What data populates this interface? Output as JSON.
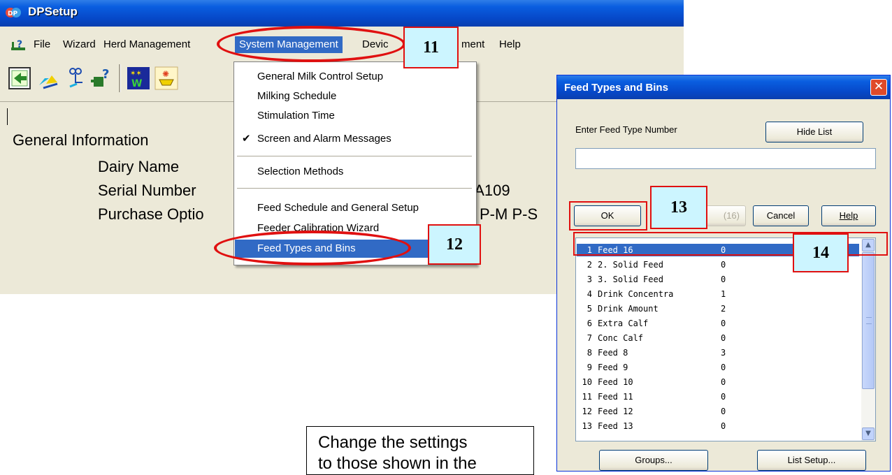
{
  "window": {
    "title": "DPSetup"
  },
  "menubar": {
    "items": [
      "File",
      "Wizard",
      "Herd Management",
      "System Management",
      "Device Management",
      "Help"
    ],
    "device_partial_left": "Devic",
    "device_partial_right": "ment"
  },
  "toolbar": {
    "icons": [
      "import-icon",
      "cursor-arrow-icon",
      "milk-network-icon",
      "plug-help-icon",
      "wizard-icon",
      "alarm-icon"
    ]
  },
  "content": {
    "section_heading": "General Information",
    "dairy_name_label": "Dairy Name",
    "serial_number_label": "Serial Number",
    "serial_number_value_partial": "7A109",
    "purchase_options_label": "Purchase Optio",
    "purchase_options_value_partial": "P-M  P-S"
  },
  "dropdown": {
    "items": [
      {
        "label": "General Milk Control Setup"
      },
      {
        "label": "Milking Schedule"
      },
      {
        "label": "Stimulation Time"
      },
      {
        "label": "Screen and Alarm Messages",
        "checked": true
      },
      {
        "label": "Selection Methods"
      },
      {
        "label": "Feed Schedule and General Setup"
      },
      {
        "label": "Feeder Calibration Wizard"
      },
      {
        "label": "Feed Types and Bins",
        "highlighted": true
      }
    ],
    "check_mark": "✔"
  },
  "callouts": {
    "c11": "11",
    "c12": "12",
    "c13": "13",
    "c14": "14"
  },
  "dialog": {
    "title": "Feed Types and Bins",
    "label": "Enter Feed Type Number",
    "hide_list_button": "Hide List",
    "input_value": "",
    "ok_button": "OK",
    "disabled_button_partial": "(16)",
    "cancel_button": "Cancel",
    "help_button": "Help",
    "groups_button": "Groups...",
    "list_setup_button": "List Setup...",
    "list": [
      {
        "num": "1",
        "name": "Feed 16",
        "value": "0",
        "selected": true
      },
      {
        "num": "2",
        "name": "2. Solid Feed",
        "value": "0"
      },
      {
        "num": "3",
        "name": "3. Solid Feed",
        "value": "0"
      },
      {
        "num": "4",
        "name": "Drink Concentra",
        "value": "1"
      },
      {
        "num": "5",
        "name": "Drink Amount",
        "value": "2"
      },
      {
        "num": "6",
        "name": "Extra Calf",
        "value": "0"
      },
      {
        "num": "7",
        "name": "Conc Calf",
        "value": "0"
      },
      {
        "num": "8",
        "name": "Feed 8",
        "value": "3"
      },
      {
        "num": "9",
        "name": "Feed 9",
        "value": "0"
      },
      {
        "num": "10",
        "name": "Feed 10",
        "value": "0"
      },
      {
        "num": "11",
        "name": "Feed 11",
        "value": "0"
      },
      {
        "num": "12",
        "name": "Feed 12",
        "value": "0"
      },
      {
        "num": "13",
        "name": "Feed 13",
        "value": "0"
      }
    ]
  },
  "note": {
    "line1": "Change the settings",
    "line2": "to those shown in the"
  },
  "colors": {
    "highlight": "#316ac5",
    "annotation_red": "#e01010",
    "callout_fill": "#ccf5ff",
    "xp_title_blue": "#0a5ee0"
  }
}
